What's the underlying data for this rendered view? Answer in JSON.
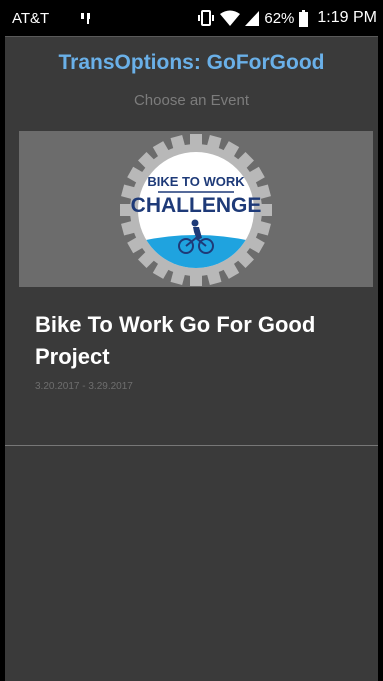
{
  "status_bar": {
    "carrier": "AT&T",
    "battery": "62%",
    "time": "1:19 PM",
    "icons": [
      "notification-icon",
      "vibrate-icon",
      "wifi-icon",
      "signal-icon",
      "battery-icon"
    ]
  },
  "app": {
    "title": "TransOptions: GoForGood",
    "subtitle": "Choose an Event",
    "accent_color": "#6ab0e8"
  },
  "events": [
    {
      "logo_text_top": "BIKE TO WORK",
      "logo_text_main": "CHALLENGE",
      "title": "Bike To Work Go For Good Project",
      "dates": "3.20.2017 - 3.29.2017"
    }
  ]
}
